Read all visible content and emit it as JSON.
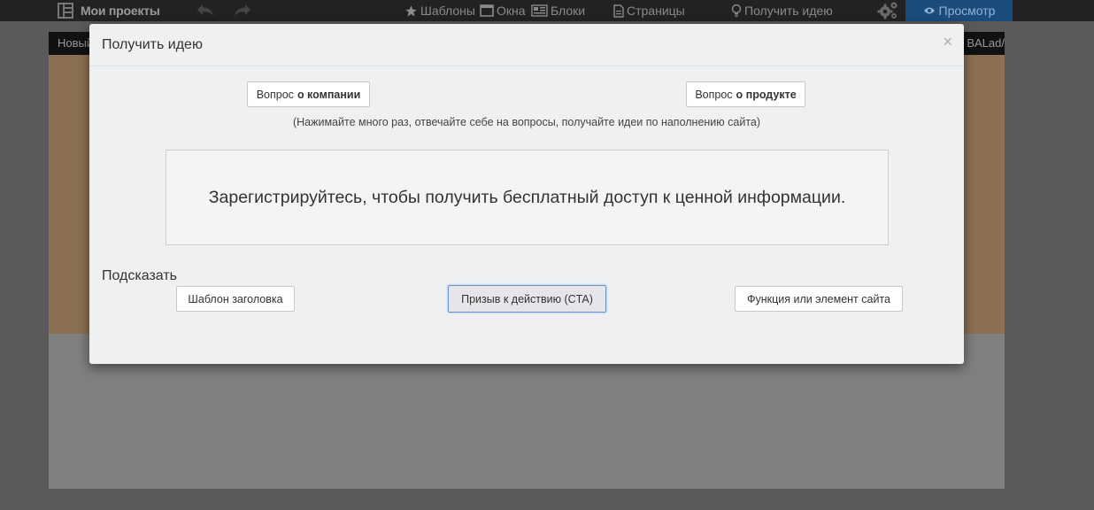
{
  "toolbar": {
    "logo_label": "Мои проекты",
    "templates_label": "Шаблоны",
    "windows_label": "Окна",
    "blocks_label": "Блоки",
    "pages_label": "Страницы",
    "get_idea_label": "Получить идею",
    "preview_label": "Просмотр",
    "icons": [
      "layout-icon",
      "undo-icon",
      "redo-icon",
      "star-icon",
      "window-icon",
      "blocks-icon",
      "page-icon",
      "lightbulb-icon",
      "gears-icon",
      "eye-icon"
    ]
  },
  "editor": {
    "path_left": "Новый",
    "path_right": "BALad/"
  },
  "modal": {
    "title": "Получить идею",
    "close_label": "×",
    "question_company_prefix": "Вопрос",
    "question_company_bold": "о компании",
    "question_product_prefix": "Вопрос",
    "question_product_bold": "о продукте",
    "hint": "(Нажимайте много раз, отвечайте себе на вопросы, получайте идеи по наполнению сайта)",
    "idea_text": "Зарегистрируйтесь, чтобы получить бесплатный доступ к ценной информации.",
    "suggest_label": "Подсказать",
    "suggest_heading": "Шаблон заголовка",
    "suggest_cta": "Призыв к действию (CTA)",
    "suggest_feature": "Функция или элемент сайта"
  },
  "colors": {
    "toolbar_bg": "#222222",
    "preview_bg": "#1c4c7c",
    "modal_bg": "#eef0f2",
    "canvas_band": "#8c7053"
  }
}
